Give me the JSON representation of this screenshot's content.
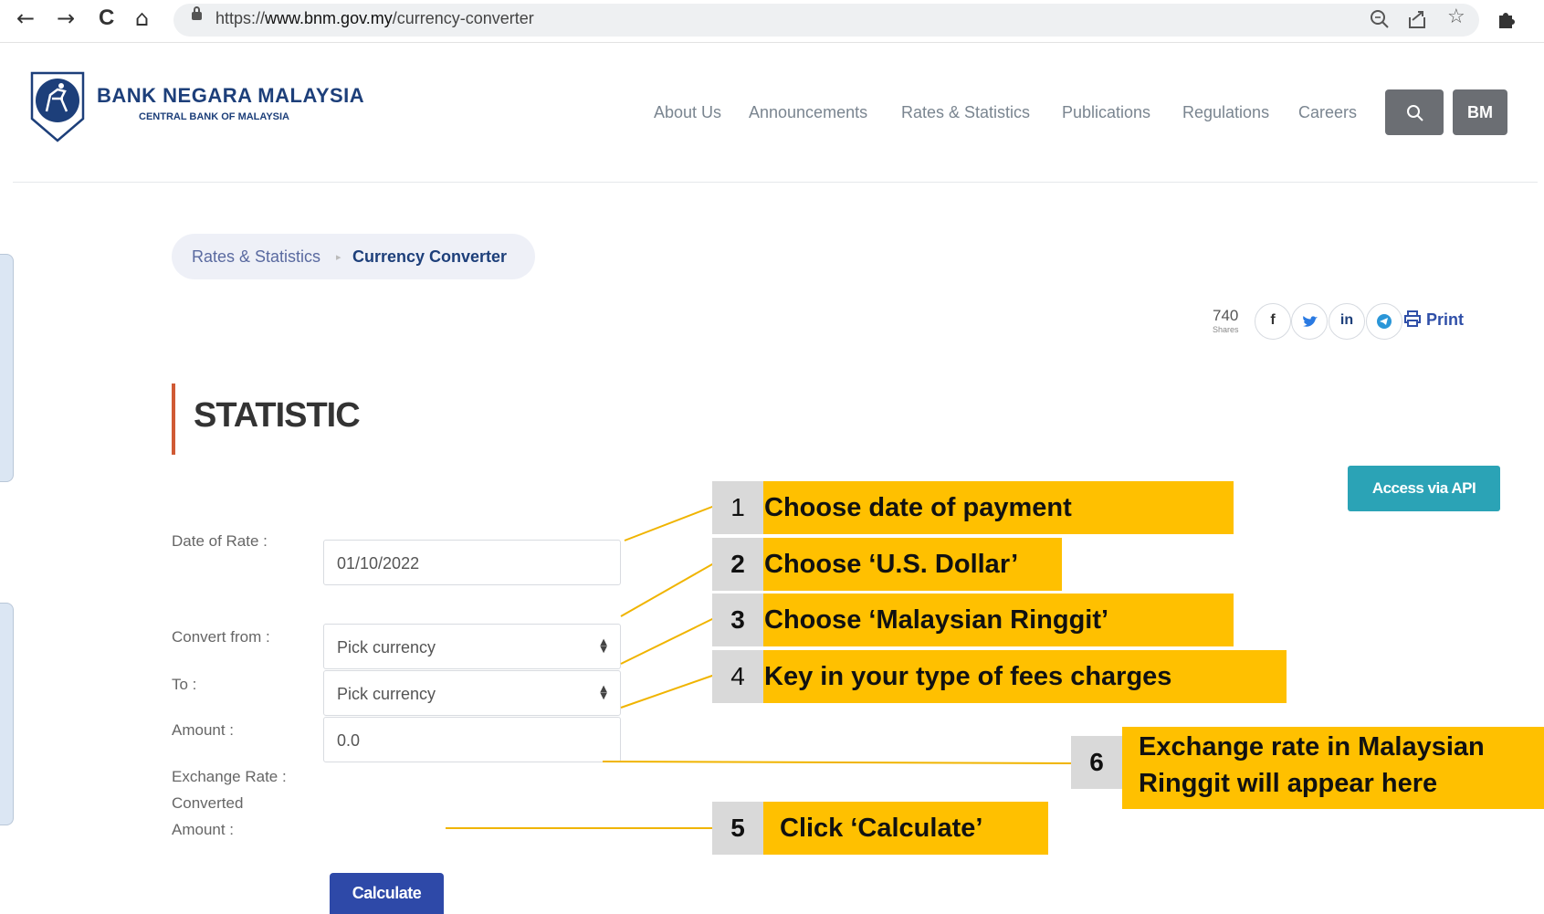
{
  "browser": {
    "nav": {
      "back": "←",
      "forward": "→",
      "reload": "C",
      "home": "⌂"
    },
    "url_scheme": "https://",
    "url_host": "www.bnm.gov.my",
    "url_path": "/currency-converter",
    "icons": [
      "zoom-icon",
      "share-icon",
      "star-icon",
      "extensions-icon"
    ]
  },
  "site": {
    "brand_name": "BANK NEGARA MALAYSIA",
    "brand_sub": "CENTRAL BANK OF MALAYSIA",
    "menu": [
      "About Us",
      "Announcements",
      "Rates & Statistics",
      "Publications",
      "Regulations",
      "Careers"
    ],
    "lang_button": "BM"
  },
  "breadcrumb": {
    "parent": "Rates & Statistics",
    "current": "Currency Converter"
  },
  "share": {
    "count": "740",
    "label": "Shares",
    "print": "Print",
    "networks": [
      "f",
      "t",
      "in",
      "tg"
    ]
  },
  "section_title": "STATISTIC",
  "api_button": "Access via API",
  "form": {
    "date_label": "Date of Rate :",
    "date_value": "01/10/2022",
    "from_label": "Convert from :",
    "from_value": "Pick currency",
    "to_label": "To :",
    "to_value": "Pick currency",
    "amount_label": "Amount :",
    "amount_value": "0.0",
    "rate_label": "Exchange Rate :",
    "converted_label_1": "Converted",
    "converted_label_2": "Amount :",
    "calculate": "Calculate"
  },
  "callouts": [
    {
      "num": "1",
      "text": "Choose date of payment"
    },
    {
      "num": "2",
      "text": "Choose ‘U.S. Dollar’"
    },
    {
      "num": "3",
      "text": "Choose ‘Malaysian Ringgit’"
    },
    {
      "num": "4",
      "text": "Key in your type of fees charges"
    },
    {
      "num": "5",
      "text": "Click ‘Calculate’"
    },
    {
      "num": "6",
      "text_line1": "Exchange rate in Malaysian",
      "text_line2": "Ringgit will appear here"
    }
  ],
  "colors": {
    "callout": "#ffc000",
    "callout_number": "#d9d9d9",
    "arrow": "#f0b400",
    "brand": "#1d3f7a",
    "accent": "#d05a35",
    "api": "#2ba3b6",
    "calculate": "#2e49a8"
  }
}
